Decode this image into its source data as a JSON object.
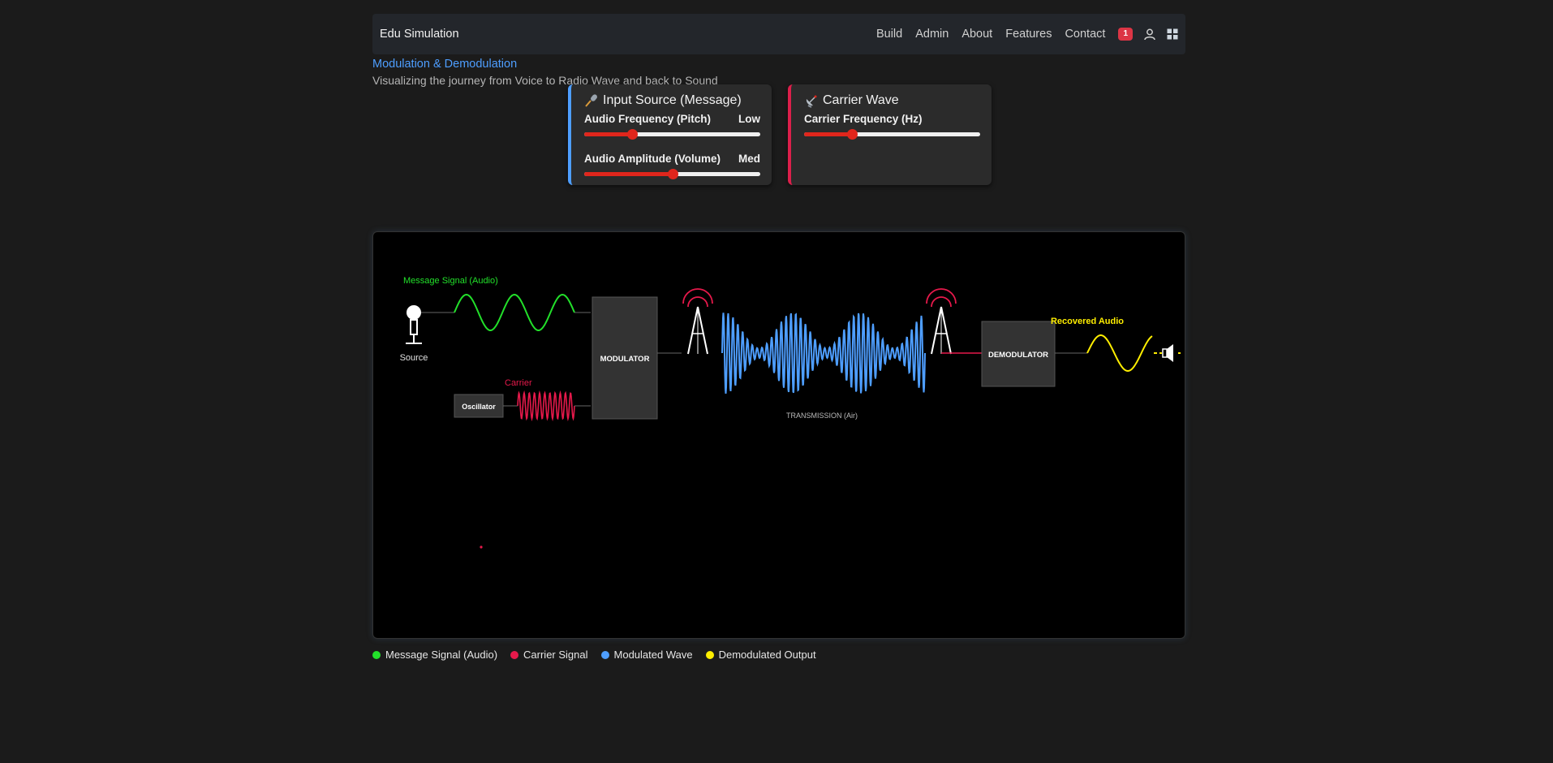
{
  "navbar": {
    "brand": "Edu Simulation",
    "links": [
      "Build",
      "Admin",
      "About",
      "Features",
      "Contact"
    ],
    "badge": "1"
  },
  "header": {
    "title": "Modulation & Demodulation",
    "subtitle": "Visualizing the journey from Voice to Radio Wave and back to Sound"
  },
  "input_panel": {
    "title": "Input Source (Message)",
    "frequency_label": "Audio Frequency (Pitch)",
    "frequency_value": "Low",
    "frequency_level": 0.27,
    "amplitude_label": "Audio Amplitude (Volume)",
    "amplitude_value": "Med",
    "amplitude_level": 0.5
  },
  "carrier_panel": {
    "title": "Carrier Wave",
    "frequency_label": "Carrier Frequency (Hz)",
    "frequency_level": 0.27
  },
  "diagram": {
    "message_label": "Message Signal (Audio)",
    "source_label": "Source",
    "carrier_label": "Carrier",
    "oscillator_label": "Oscillator",
    "modulator_label": "MODULATOR",
    "transmission_label": "TRANSMISSION (Air)",
    "demodulator_label": "DEMODULATOR",
    "recovered_label": "Recovered Audio"
  },
  "legend": [
    {
      "label": "Message Signal (Audio)",
      "color": "#22e02a"
    },
    {
      "label": "Carrier Signal",
      "color": "#e6194b"
    },
    {
      "label": "Modulated Wave",
      "color": "#4e9eff"
    },
    {
      "label": "Demodulated Output",
      "color": "#ffee00"
    }
  ],
  "colors": {
    "message": "#22e02a",
    "carrier": "#e6194b",
    "modulated": "#4e9eff",
    "demodulated": "#ffee00"
  }
}
